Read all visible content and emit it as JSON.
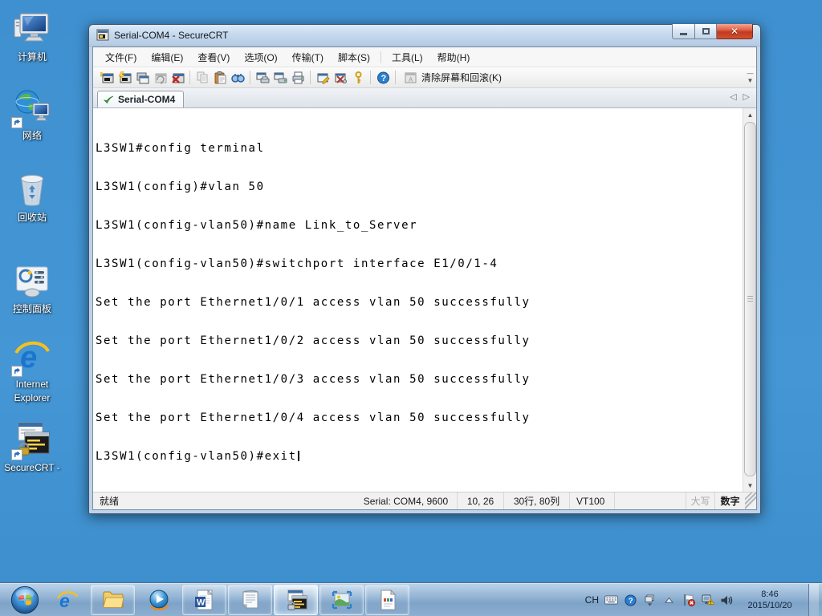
{
  "colors": {
    "desktop_bg": "#4193d1",
    "titlebar": "#c6d9ee",
    "close_button_red": "#d2502f",
    "terminal_bg": "#ffffff",
    "terminal_fg": "#000000",
    "taskbar_blue": "#8db0d0",
    "tab_check_green": "#46a546"
  },
  "desktop": {
    "icons": [
      {
        "label": "计算机",
        "icon": "computer-icon"
      },
      {
        "label": "网络",
        "icon": "network-icon"
      },
      {
        "label": "回收站",
        "icon": "recycle-bin-icon"
      },
      {
        "label": "控制面板",
        "icon": "control-panel-icon"
      },
      {
        "label": "Internet Explorer",
        "icon": "internet-explorer-icon"
      },
      {
        "label": "SecureCRT -",
        "icon": "securecrt-shortcut-icon"
      }
    ]
  },
  "window": {
    "title": "Serial-COM4 - SecureCRT",
    "menu": {
      "items": [
        {
          "label": "文件(F)"
        },
        {
          "label": "编辑(E)"
        },
        {
          "label": "查看(V)"
        },
        {
          "label": "选项(O)"
        },
        {
          "label": "传输(T)"
        },
        {
          "label": "脚本(S)"
        },
        {
          "label": "工具(L)"
        },
        {
          "label": "帮助(H)"
        }
      ]
    },
    "toolbar": {
      "icon_names": [
        "connect-icon",
        "quick-connect-icon",
        "connect-in-tab-icon",
        "reconnect-icon",
        "disconnect-icon",
        "copy-icon",
        "paste-icon",
        "find-icon",
        "print-preview-icon",
        "print-setup-icon",
        "print-icon",
        "session-options-icon",
        "global-options-icon",
        "keymap-icon",
        "help-icon",
        "clear-screen-icon"
      ],
      "clear_screen_label": "清除屏幕和回滚(K)"
    },
    "tab": {
      "label": "Serial-COM4",
      "status_icon": "check-mark"
    },
    "terminal": {
      "lines": [
        "L3SW1#config terminal",
        "L3SW1(config)#vlan 50",
        "L3SW1(config-vlan50)#name Link_to_Server",
        "L3SW1(config-vlan50)#switchport interface E1/0/1-4",
        "Set the port Ethernet1/0/1 access vlan 50 successfully",
        "Set the port Ethernet1/0/2 access vlan 50 successfully",
        "Set the port Ethernet1/0/3 access vlan 50 successfully",
        "Set the port Ethernet1/0/4 access vlan 50 successfully",
        "L3SW1(config-vlan50)#exit"
      ]
    },
    "status": {
      "ready": "就绪",
      "serial": "Serial: COM4, 9600",
      "cursor_pos": "10, 26",
      "rows_cols": "30行, 80列",
      "emulation": "VT100",
      "caps_lock": "大写",
      "num_lock": "数字"
    }
  },
  "taskbar": {
    "app_icons": [
      "start-orb",
      "internet-explorer",
      "windows-explorer",
      "media-player",
      "word",
      "notepad",
      "securecrt",
      "image-viewer",
      "script-document"
    ],
    "tray": {
      "lang": "CH",
      "icon_names": [
        "keyboard-icon",
        "help-icon",
        "window-popup-icon",
        "show-hidden-icons-arrow",
        "action-center-flag-icon",
        "network-warning-icon",
        "volume-icon"
      ]
    },
    "clock": {
      "time": "8:46",
      "date": "2015/10/20"
    }
  }
}
